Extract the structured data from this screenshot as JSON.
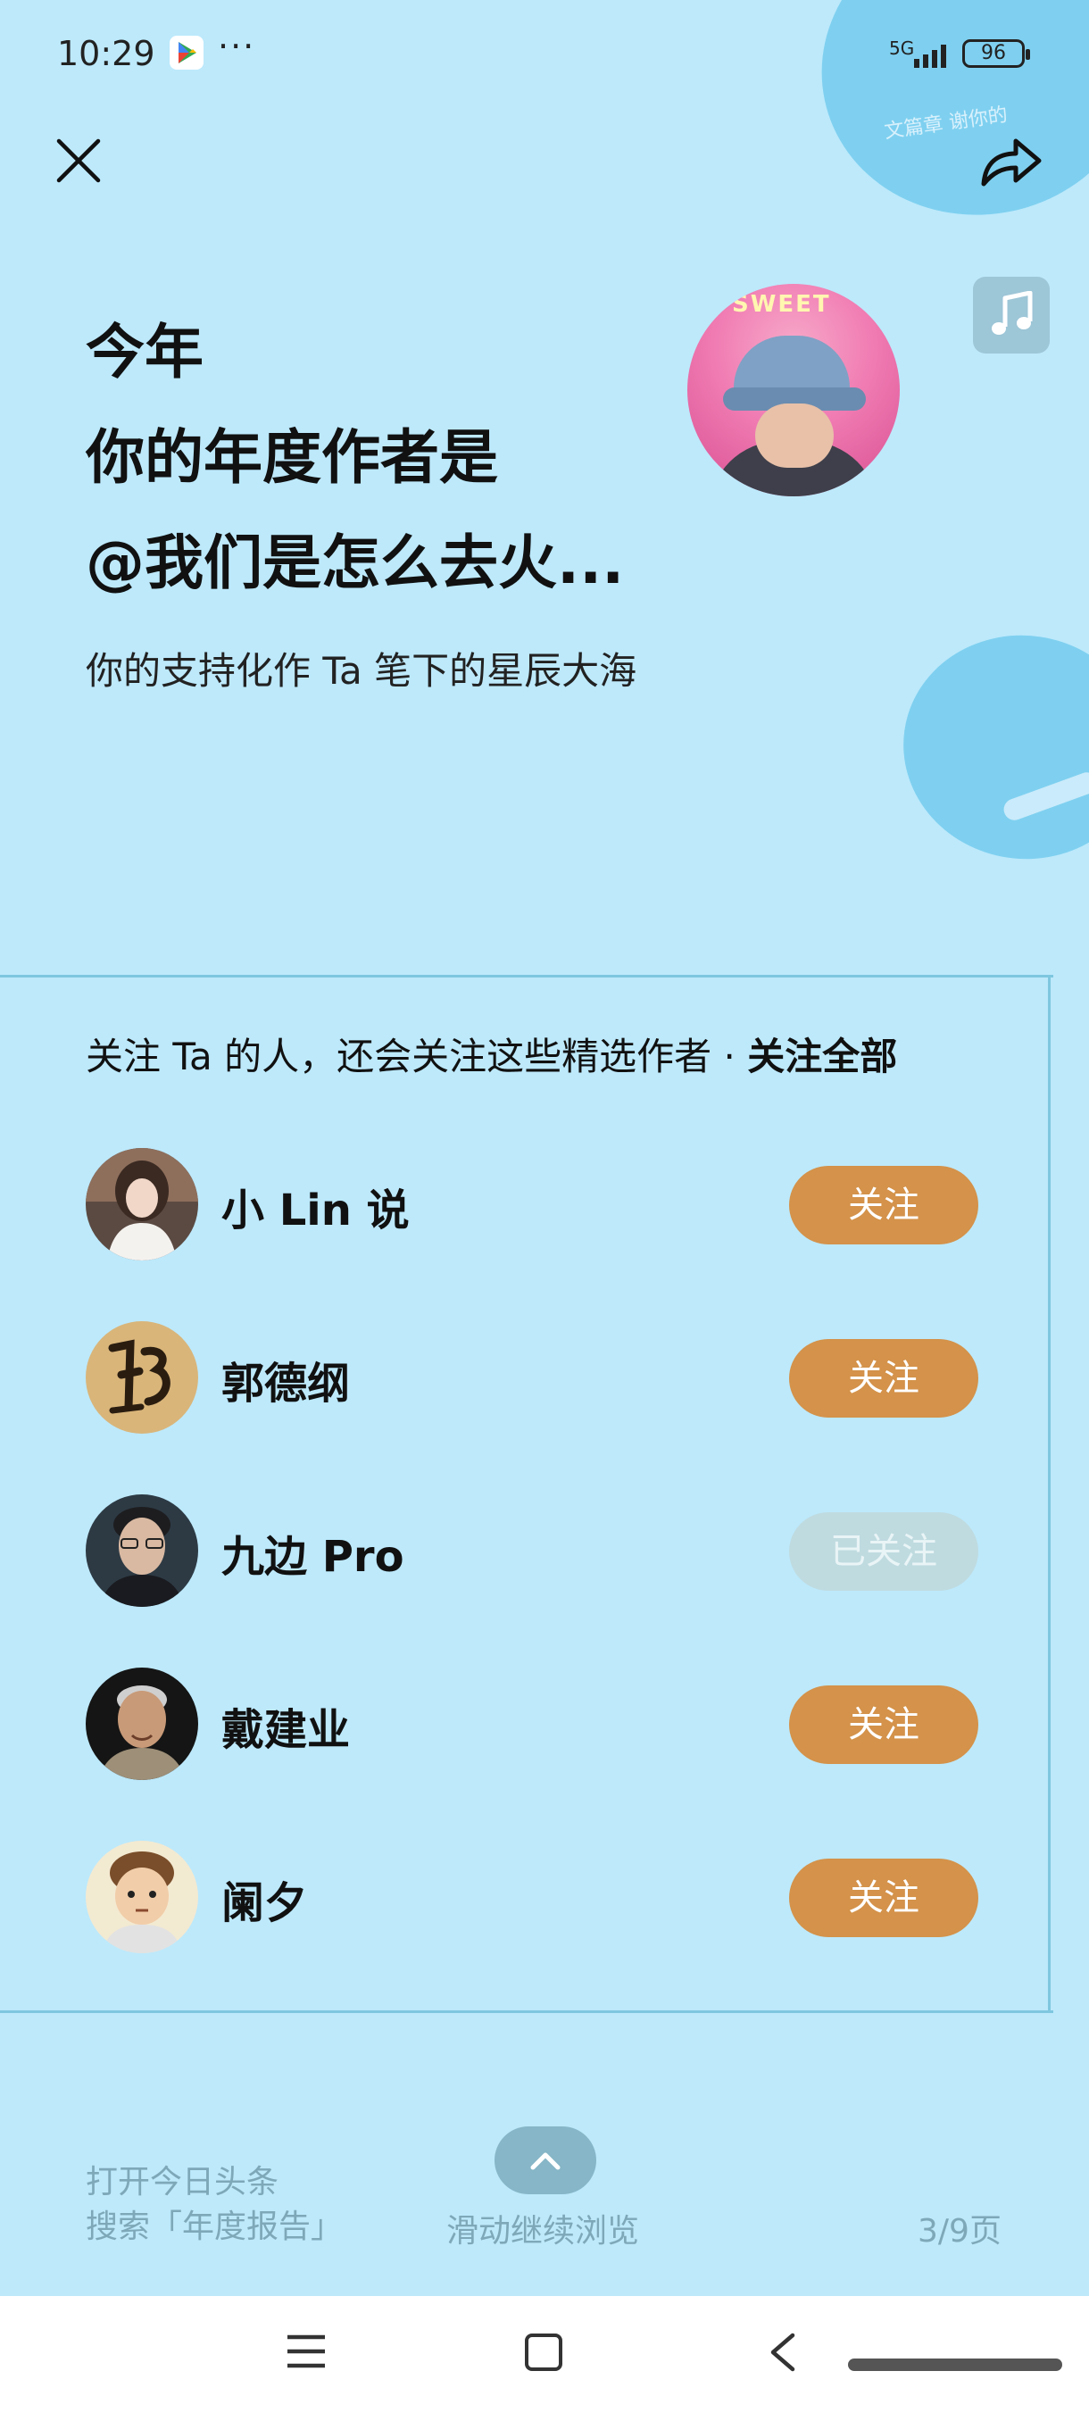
{
  "status_bar": {
    "time": "10:29",
    "more": "···",
    "network": "5G",
    "battery": "96"
  },
  "header": {
    "headline_line1": "今年",
    "headline_line2": "你的年度作者是",
    "headline_line3": "@我们是怎么去火...",
    "subtitle": "你的支持化作 Ta 笔下的星辰大海",
    "avatar_text": "SWEET"
  },
  "recommend": {
    "title": "关注 Ta 的人，还会关注这些精选作者 · ",
    "follow_all": "关注全部",
    "authors": [
      {
        "name": "小 Lin 说",
        "button": "关注",
        "followed": false
      },
      {
        "name": "郭德纲",
        "button": "关注",
        "followed": false
      },
      {
        "name": "九边 Pro",
        "button": "已关注",
        "followed": true
      },
      {
        "name": "戴建业",
        "button": "关注",
        "followed": false
      },
      {
        "name": "阑夕",
        "button": "关注",
        "followed": false
      }
    ]
  },
  "footer": {
    "left_line1": "打开今日头条",
    "left_line2": "搜索「年度报告」",
    "center": "滑动继续浏览",
    "page": "3/9页"
  },
  "colors": {
    "background": "#bde9fb",
    "follow_button": "#d4924a",
    "followed_button": "#bfdbe0"
  }
}
